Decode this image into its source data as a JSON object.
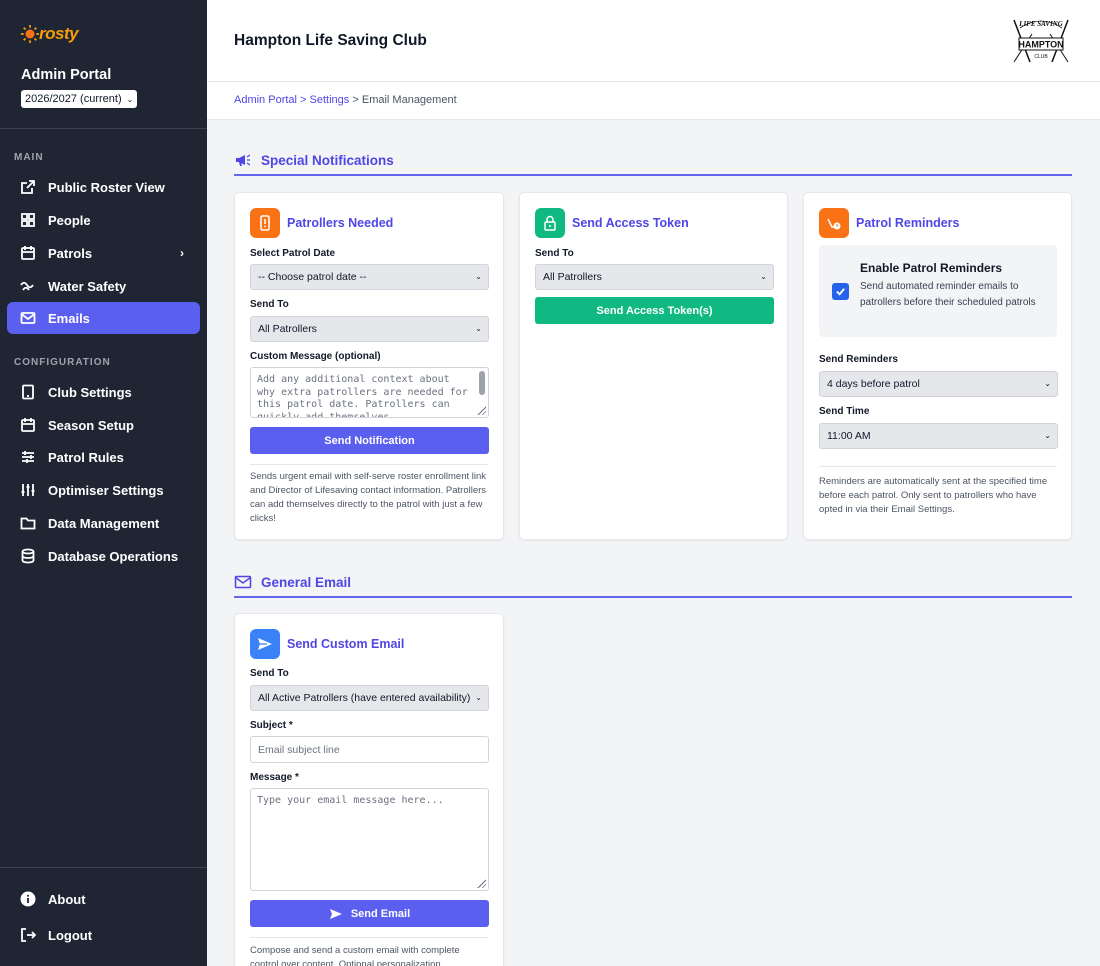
{
  "brand": {
    "logo_text": "rosty",
    "portal_title": "Admin Portal",
    "season": "2026/2027 (current)"
  },
  "sidebar": {
    "main_label": "MAIN",
    "main_items": [
      {
        "label": "Public Roster View",
        "icon": "external-link-icon"
      },
      {
        "label": "People",
        "icon": "grid-icon"
      },
      {
        "label": "Patrols",
        "icon": "calendar-icon"
      },
      {
        "label": "Water Safety",
        "icon": "water-icon"
      },
      {
        "label": "Emails",
        "icon": "mail-icon",
        "active": true
      }
    ],
    "config_label": "CONFIGURATION",
    "config_items": [
      {
        "label": "Club Settings",
        "icon": "tablet-icon"
      },
      {
        "label": "Season Setup",
        "icon": "calendar-icon"
      },
      {
        "label": "Patrol Rules",
        "icon": "sliders-icon"
      },
      {
        "label": "Optimiser Settings",
        "icon": "adjust-icon"
      },
      {
        "label": "Data Management",
        "icon": "folder-icon"
      },
      {
        "label": "Database Operations",
        "icon": "database-icon"
      }
    ],
    "footer_items": [
      {
        "label": "About",
        "icon": "info-icon"
      },
      {
        "label": "Logout",
        "icon": "logout-icon"
      }
    ]
  },
  "header": {
    "club_name": "Hampton Life Saving Club",
    "logo_top": "LIFE SAVING",
    "logo_mid": "HAMPTON",
    "logo_bottom": "CLUB"
  },
  "breadcrumb": {
    "root": "Admin Portal",
    "sep": ">",
    "middle": "Settings",
    "current": "Email Management"
  },
  "special": {
    "heading": "Special Notifications",
    "patrollers_needed": {
      "title": "Patrollers Needed",
      "date_label": "Select Patrol Date",
      "date_value": "-- Choose patrol date --",
      "send_to_label": "Send To",
      "send_to_value": "All Patrollers",
      "message_label": "Custom Message (optional)",
      "message_placeholder": "Add any additional context about why extra patrollers are needed for this patrol date. Patrollers can quickly add themselves...",
      "button": "Send Notification",
      "help": "Sends urgent email with self-serve roster enrollment link and Director of Lifesaving contact information. Patrollers can add themselves directly to the patrol with just a few clicks!"
    },
    "access_token": {
      "title": "Send Access Token",
      "send_to_label": "Send To",
      "send_to_value": "All Patrollers",
      "button": "Send Access Token(s)"
    },
    "reminders": {
      "title": "Patrol Reminders",
      "enable_title": "Enable Patrol Reminders",
      "enable_desc": "Send automated reminder emails to patrollers before their scheduled patrols",
      "send_reminders_label": "Send Reminders",
      "send_reminders_value": "4 days before patrol",
      "send_time_label": "Send Time",
      "send_time_value": "11:00 AM",
      "help": "Reminders are automatically sent at the specified time before each patrol. Only sent to patrollers who have opted in via their Email Settings."
    }
  },
  "general": {
    "heading": "General Email",
    "custom": {
      "title": "Send Custom Email",
      "send_to_label": "Send To",
      "send_to_value": "All Active Patrollers (have entered availability)",
      "subject_label": "Subject *",
      "subject_placeholder": "Email subject line",
      "message_label": "Message *",
      "message_placeholder": "Type your email message here...",
      "button": "Send Email",
      "help": "Compose and send a custom email with complete control over content. Optional personalization"
    }
  },
  "colors": {
    "sidebar_bg": "#1f2533",
    "accent": "#5b5ff0",
    "green": "#10b981",
    "orange": "#f97316",
    "blue": "#3b82f6"
  }
}
